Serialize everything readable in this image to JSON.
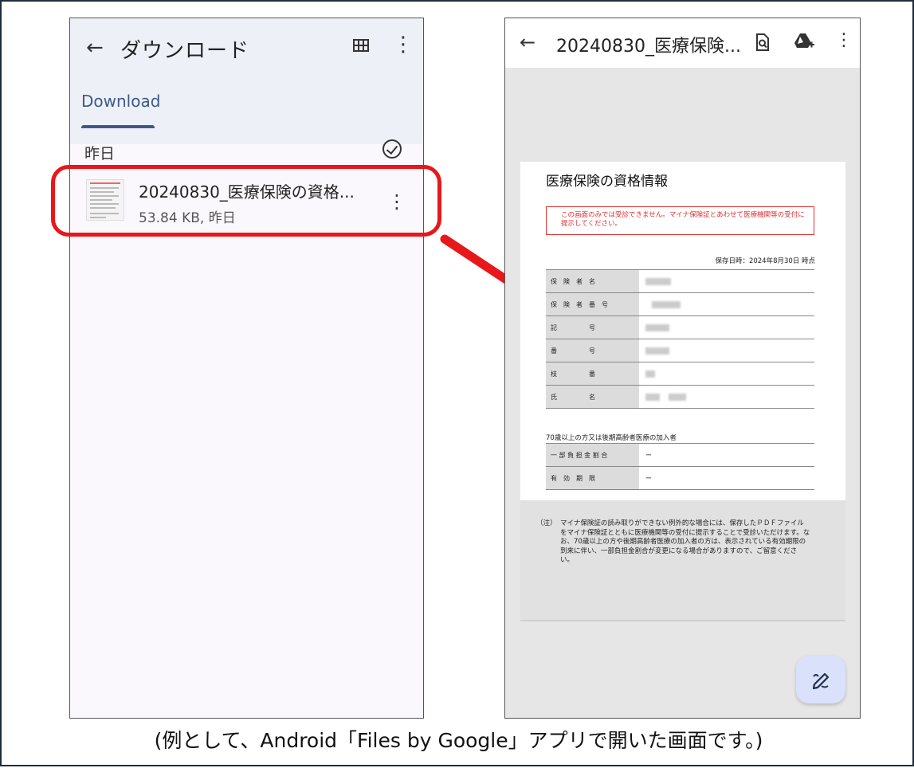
{
  "left_screen": {
    "back_icon": "arrow-left-icon",
    "title": "ダウンロード",
    "grid_icon": "grid-view-icon",
    "more_icon": "more-vert-icon",
    "tab_label": "Download",
    "section_date": "昨日",
    "check_icon": "check-circle-icon",
    "file": {
      "name": "20240830_医療保険の資格...",
      "meta": "53.84 KB, 昨日"
    }
  },
  "right_screen": {
    "back_icon": "arrow-left-icon",
    "title": "20240830_医療保険...",
    "icons": [
      "search-document-icon",
      "drive-add-icon",
      "more-vert-icon"
    ],
    "document": {
      "heading": "医療保険の資格情報",
      "warning": "この画面のみでは受診できません。マイナ保険証とあわせて医療機関等の受付に提示してください。",
      "saved_at": "保存日時：2024年8月30日 時点",
      "rows": [
        {
          "label": "保　険　者　名"
        },
        {
          "label": "保　険　者　番　号"
        },
        {
          "label": "記　　　　　号"
        },
        {
          "label": "番　　　　　号"
        },
        {
          "label": "枝　　　　　番"
        },
        {
          "label": "氏　　　　　名"
        }
      ],
      "senior_heading": "70歳以上の方又は後期高齢者医療の加入者",
      "senior_rows": [
        {
          "label": "一 部 負 担 金 割 合",
          "value": "ー"
        },
        {
          "label": "有　効　期　限",
          "value": "ー"
        }
      ],
      "note_label": "（注）",
      "note": "マイナ保険証の読み取りができない例外的な場合には、保存したＰＤＦファイルをマイナ保険証とともに医療機関等の受付に提示することで受診いただけます。なお、70歳以上の方や後期高齢者医療の加入者の方は、表示されている有効期限の到来に伴い、一部負担金割合が変更になる場合がありますので、ご留意ください。"
    },
    "fab_icon": "edit-pen-icon"
  },
  "caption": "(例として、Android「Files by Google」アプリで開いた画面です。)",
  "colors": {
    "highlight": "#e8171b",
    "tab_accent": "#3b5a8a",
    "fab": "#d9e1fb"
  }
}
